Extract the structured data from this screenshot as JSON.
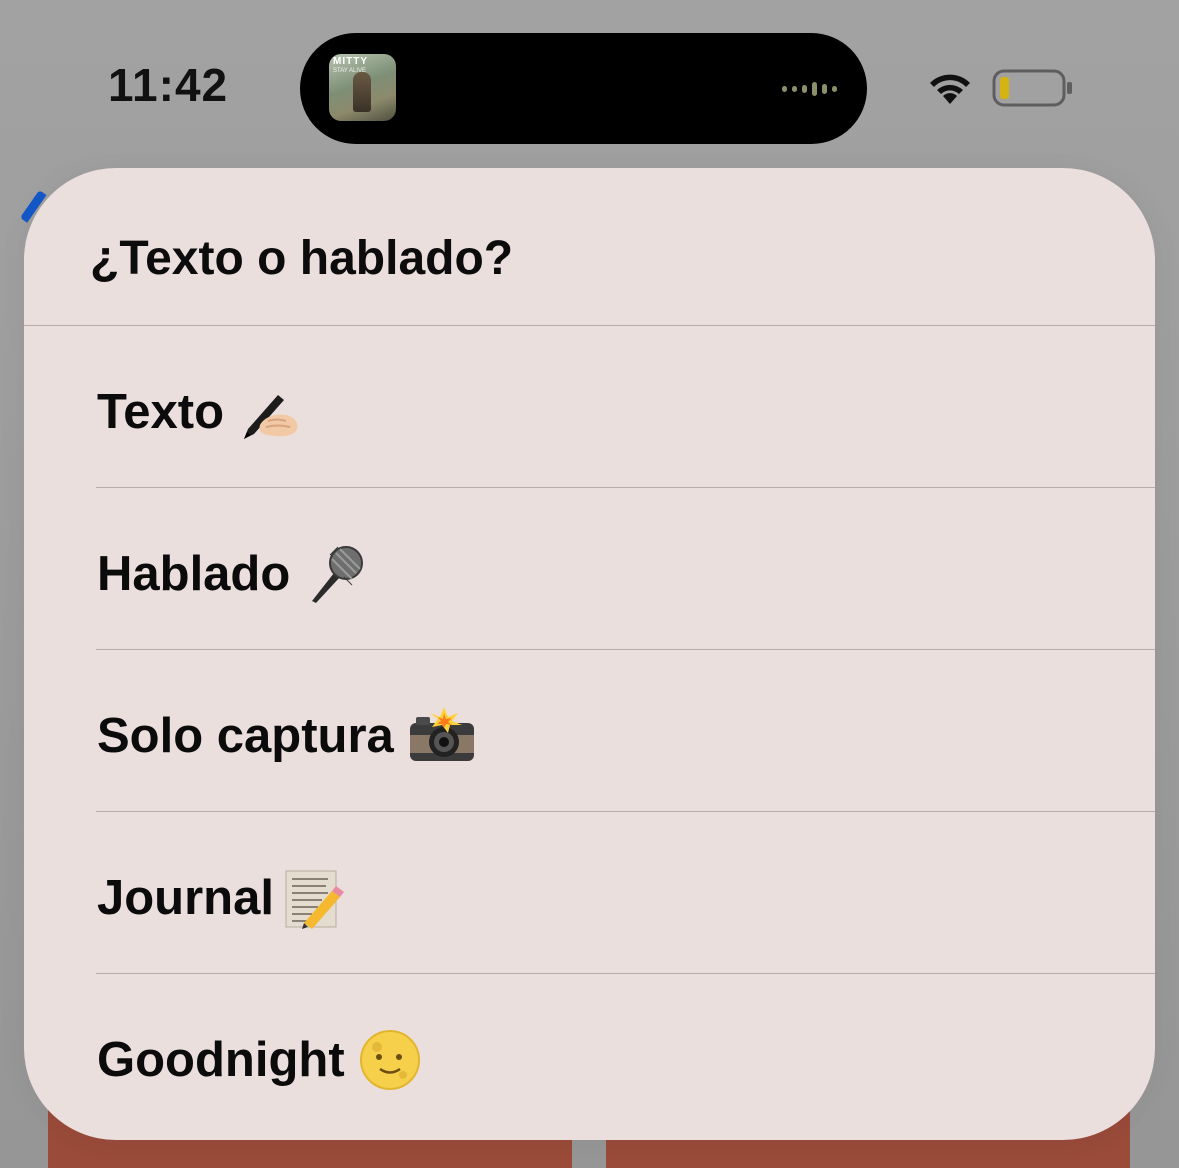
{
  "status_bar": {
    "time": "11:42",
    "now_playing": {
      "art_title": "MITTY",
      "art_subtitle": "STAY ALIVE"
    }
  },
  "sheet": {
    "title": "¿Texto o hablado?",
    "options": [
      {
        "label": "Texto",
        "icon": "writing-hand-icon"
      },
      {
        "label": "Hablado",
        "icon": "microphone-icon"
      },
      {
        "label": "Solo captura",
        "icon": "camera-flash-icon"
      },
      {
        "label": "Journal",
        "icon": "memo-icon"
      },
      {
        "label": "Goodnight",
        "icon": "full-moon-face-icon"
      }
    ]
  }
}
